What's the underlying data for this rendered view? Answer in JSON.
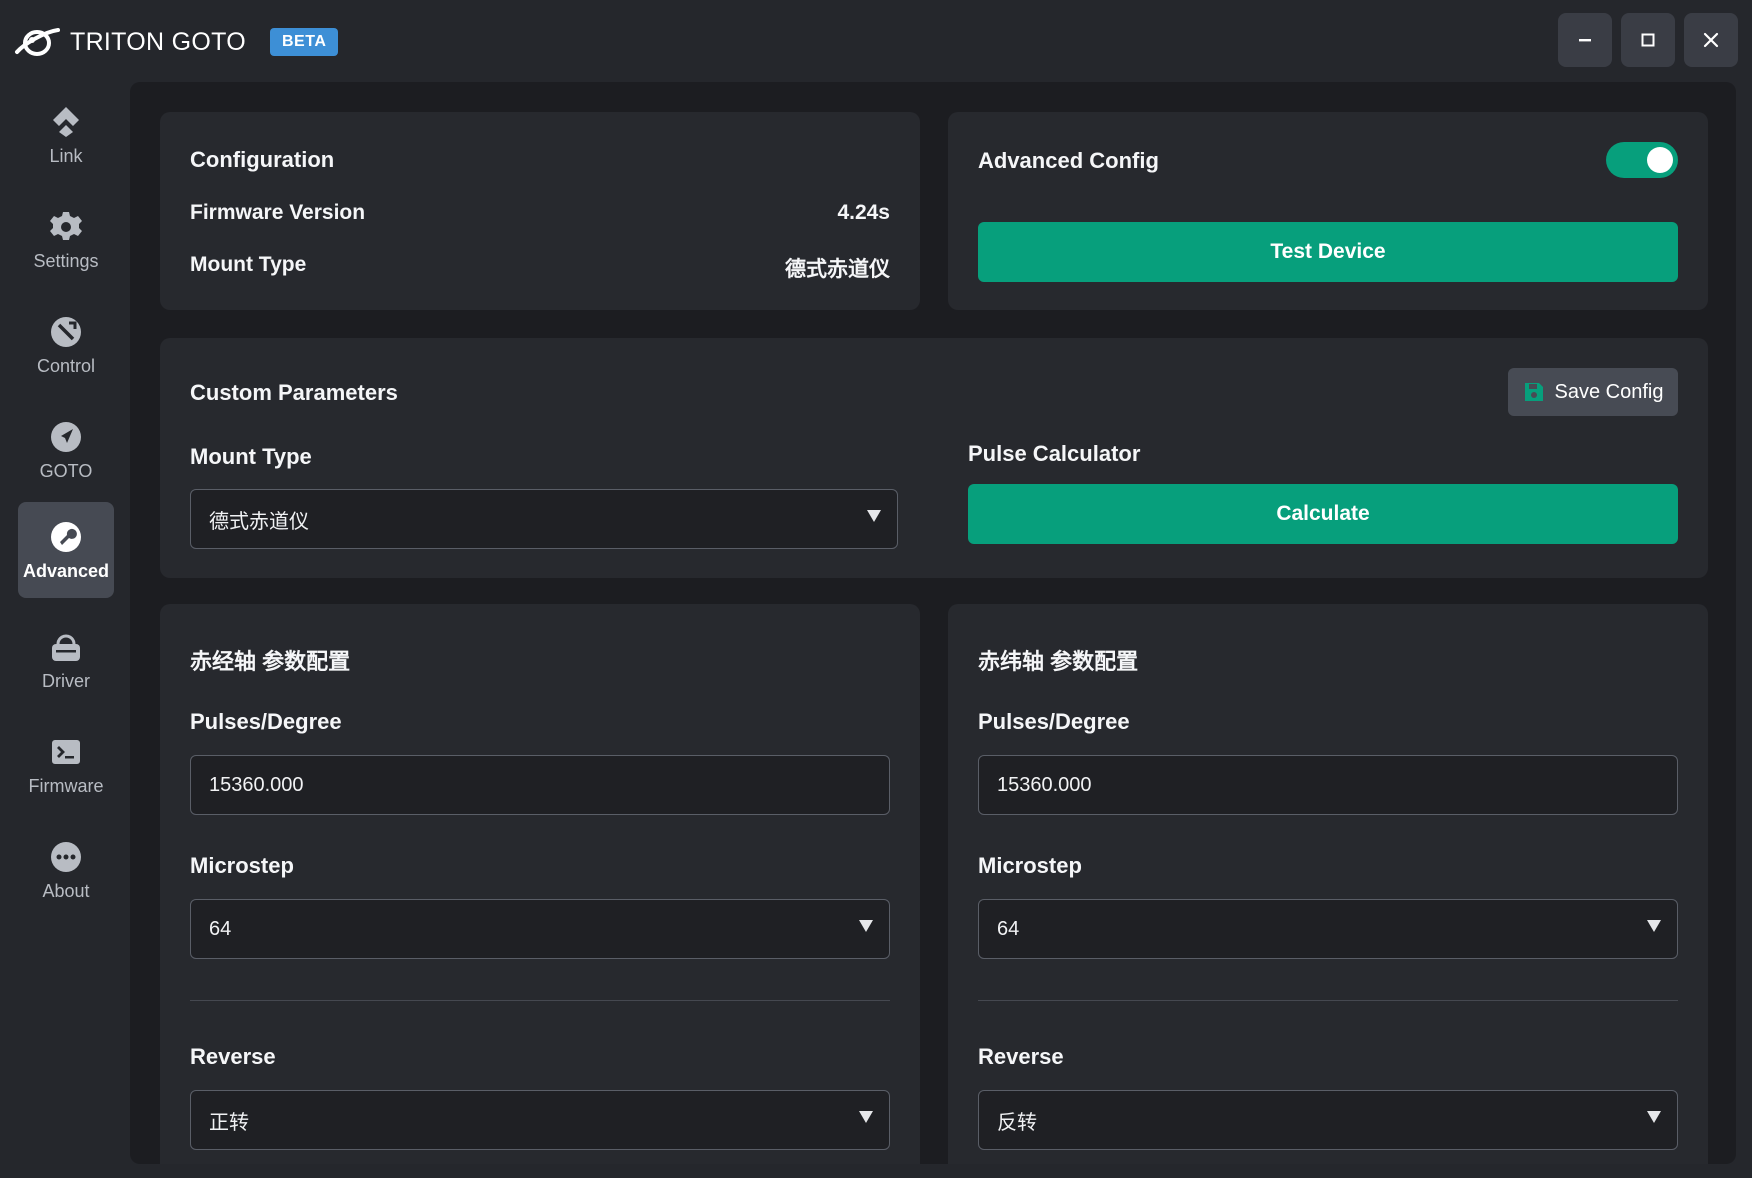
{
  "app": {
    "title": "TRITON GOTO",
    "badge": "BETA"
  },
  "sidebar": {
    "items": [
      {
        "label": "Link",
        "icon": "link-diamond-icon"
      },
      {
        "label": "Settings",
        "icon": "gear-icon"
      },
      {
        "label": "Control",
        "icon": "compass-slash-icon"
      },
      {
        "label": "GOTO",
        "icon": "navigation-arrow-icon"
      },
      {
        "label": "Advanced",
        "icon": "wrench-circle-icon",
        "active": true
      },
      {
        "label": "Driver",
        "icon": "driver-box-icon"
      },
      {
        "label": "Firmware",
        "icon": "terminal-icon"
      },
      {
        "label": "About",
        "icon": "ellipsis-circle-icon"
      }
    ]
  },
  "configuration": {
    "title": "Configuration",
    "firmware_label": "Firmware Version",
    "firmware_value": "4.24s",
    "mount_label": "Mount Type",
    "mount_value": "德式赤道仪"
  },
  "advanced_config": {
    "title": "Advanced Config",
    "toggle_on": true,
    "test_button": "Test Device"
  },
  "custom_params": {
    "title": "Custom Parameters",
    "save_button": "Save Config",
    "mount_label": "Mount Type",
    "mount_value": "德式赤道仪",
    "pulse_label": "Pulse Calculator",
    "calculate_button": "Calculate"
  },
  "ra_axis": {
    "title": "赤经轴 参数配置",
    "pulses_label": "Pulses/Degree",
    "pulses_value": "15360.000",
    "microstep_label": "Microstep",
    "microstep_value": "64",
    "reverse_label": "Reverse",
    "reverse_value": "正转"
  },
  "dec_axis": {
    "title": "赤纬轴 参数配置",
    "pulses_label": "Pulses/Degree",
    "pulses_value": "15360.000",
    "microstep_label": "Microstep",
    "microstep_value": "64",
    "reverse_label": "Reverse",
    "reverse_value": "反转"
  },
  "colors": {
    "accent": "#079f7c",
    "badge": "#3d8fd6",
    "background": "#25272c",
    "panel": "#27292e"
  }
}
